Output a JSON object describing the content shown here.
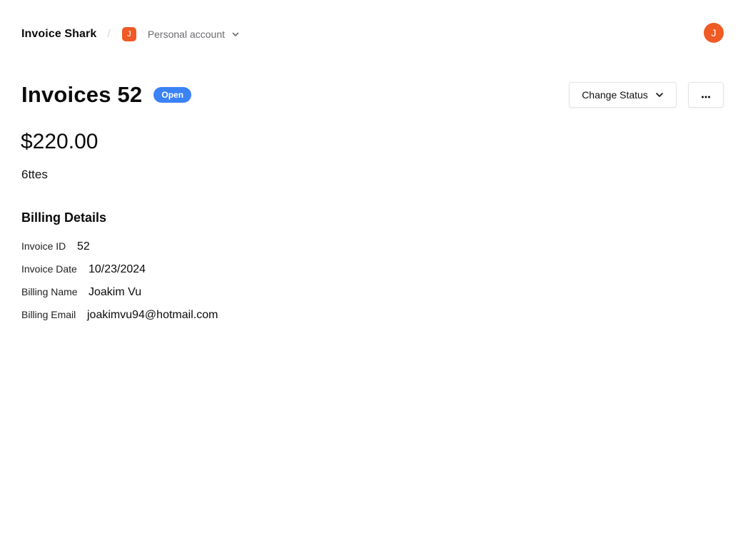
{
  "header": {
    "brand": "Invoice Shark",
    "separator": "/",
    "account": {
      "initial": "J",
      "name": "Personal account"
    },
    "user_avatar_initial": "J"
  },
  "invoice": {
    "title": "Invoices 52",
    "status": "Open",
    "amount": "$220.00",
    "description": "6ttes"
  },
  "actions": {
    "change_status_label": "Change Status",
    "more_label": "···"
  },
  "billing": {
    "heading": "Billing Details",
    "fields": [
      {
        "label": "Invoice ID",
        "value": "52"
      },
      {
        "label": "Invoice Date",
        "value": "10/23/2024"
      },
      {
        "label": "Billing Name",
        "value": "Joakim Vu"
      },
      {
        "label": "Billing Email",
        "value": "joakimvu94@hotmail.com"
      }
    ]
  },
  "colors": {
    "accent": "#f05a24",
    "status_open": "#3b82f6"
  },
  "icons": [
    "chevron-down-icon",
    "more-horizontal-icon"
  ]
}
